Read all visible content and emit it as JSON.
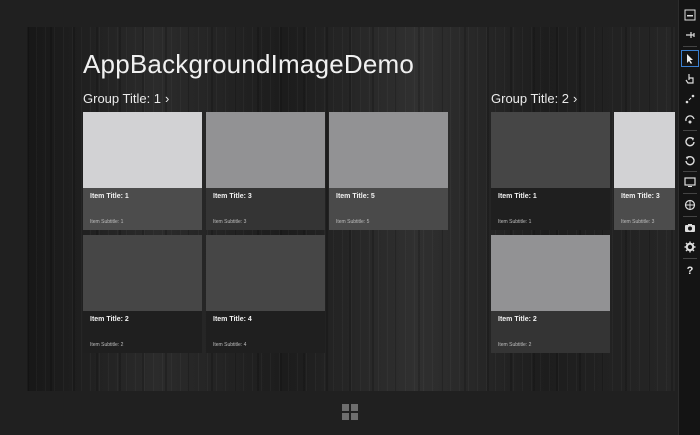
{
  "app": {
    "title": "AppBackgroundImageDemo"
  },
  "colors": {
    "tile_light": "#d6d6d8",
    "tile_mid": "#929294",
    "tile_dark": "#4a4a4a",
    "tile_darker": "#3f3f3f"
  },
  "groups": [
    {
      "title": "Group Title: 1",
      "chevron": "›",
      "items": [
        {
          "title": "Item Title: 1",
          "subtitle": "Item Subtitle: 1",
          "image": "#d2d2d4",
          "meta": "#4c4c4c"
        },
        {
          "title": "Item Title: 3",
          "subtitle": "Item Subtitle: 3",
          "image": "#929294",
          "meta": "#343434"
        },
        {
          "title": "Item Title: 5",
          "subtitle": "Item Subtitle: 5",
          "image": "#929294",
          "meta": "#4a4a4a"
        },
        {
          "title": "Item Title: 2",
          "subtitle": "Item Subtitle: 2",
          "image": "#464646",
          "meta": "#1f1f1f"
        },
        {
          "title": "Item Title: 4",
          "subtitle": "Item Subtitle: 4",
          "image": "#464646",
          "meta": "#1f1f1f"
        }
      ]
    },
    {
      "title": "Group Title: 2",
      "chevron": "›",
      "items": [
        {
          "title": "Item Title: 1",
          "subtitle": "Item Subtitle: 1",
          "image": "#464646",
          "meta": "#1f1f1f"
        },
        {
          "title": "Item Title: 3",
          "subtitle": "Item Subtitle: 3",
          "image": "#d2d2d4",
          "meta": "#4c4c4c"
        },
        {
          "title": "Item Title: 2",
          "subtitle": "Item Subtitle: 2",
          "image": "#929294",
          "meta": "#343434"
        }
      ]
    }
  ],
  "simulator_toolbar": [
    "minimize-icon",
    "pin-icon",
    "mouse-mode-icon",
    "touch-mode-icon",
    "pinch-zoom-icon",
    "rotate-touch-icon",
    "rotate-clockwise-icon",
    "rotate-counterclockwise-icon",
    "resolution-icon",
    "location-icon",
    "screenshot-icon",
    "settings-icon",
    "help-icon"
  ],
  "help_glyph": "?"
}
